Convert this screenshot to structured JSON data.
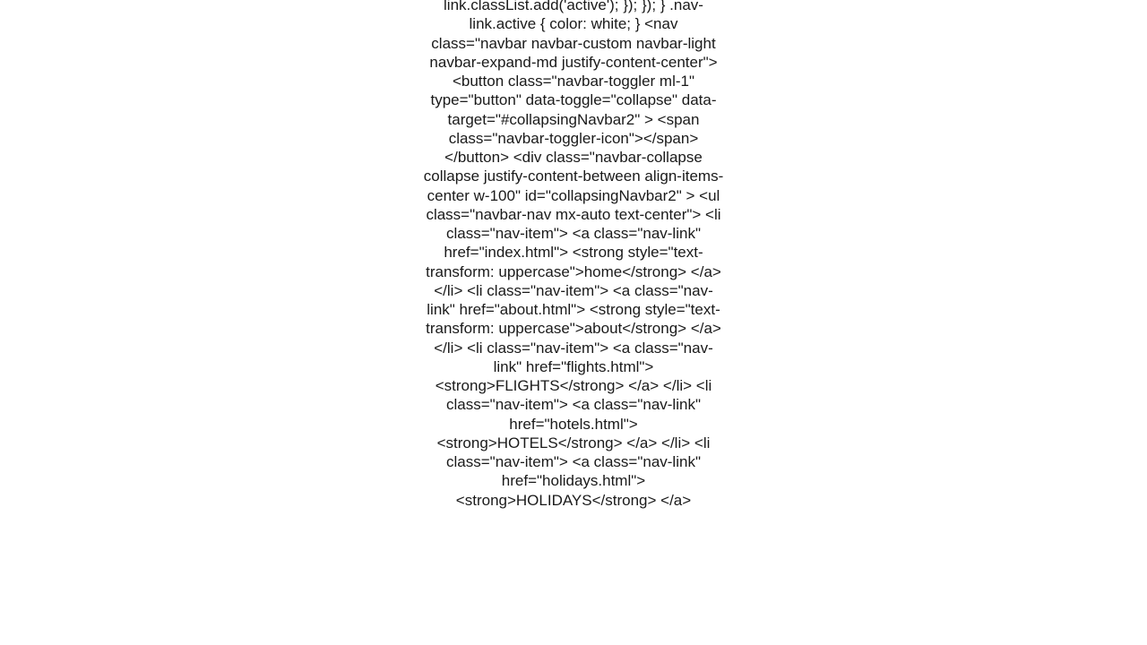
{
  "code_text": "link.classList.add('active');     });   }); } .nav-link.active {   color: white; } <nav class=\"navbar navbar-custom navbar-light navbar-expand-md justify-content-center\">   <button     class=\"navbar-toggler ml-1\"     type=\"button\"     data-toggle=\"collapse\"     data-target=\"#collapsingNavbar2\"   >     <span class=\"navbar-toggler-icon\"></span>   </button>   <div     class=\"navbar-collapse collapse justify-content-between align-items-center w-100\"     id=\"collapsingNavbar2\"   >     <ul class=\"navbar-nav mx-auto text-center\">       <li class=\"nav-item\">         <a class=\"nav-link\" href=\"index.html\">           <strong style=\"text-transform: uppercase\">home</strong>         </a>       </li>       <li class=\"nav-item\">         <a class=\"nav-link\" href=\"about.html\">           <strong style=\"text-transform: uppercase\">about</strong>         </a>       </li>       <li class=\"nav-item\">         <a class=\"nav-link\" href=\"flights.html\">           <strong>FLIGHTS</strong>         </a>       </li>       <li class=\"nav-item\">         <a class=\"nav-link\" href=\"hotels.html\">           <strong>HOTELS</strong>         </a>       </li>       <li class=\"nav-item\">         <a class=\"nav-link\" href=\"holidays.html\">           <strong>HOLIDAYS</strong>         </a>"
}
